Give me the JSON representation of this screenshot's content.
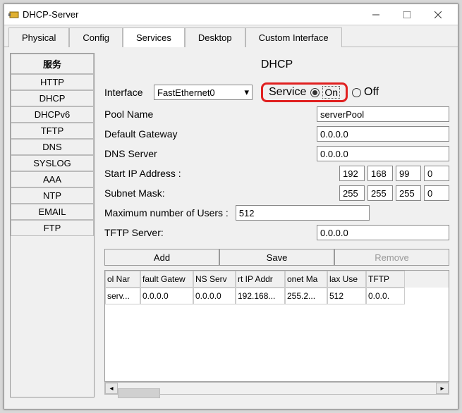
{
  "window": {
    "title": "DHCP-Server"
  },
  "tabs": [
    "Physical",
    "Config",
    "Services",
    "Desktop",
    "Custom Interface"
  ],
  "active_tab": "Services",
  "sidebar": {
    "header": "服务",
    "items": [
      "HTTP",
      "DHCP",
      "DHCPv6",
      "TFTP",
      "DNS",
      "SYSLOG",
      "AAA",
      "NTP",
      "EMAIL",
      "FTP"
    ]
  },
  "panel": {
    "title": "DHCP",
    "interface_label": "Interface",
    "interface_value": "FastEthernet0",
    "service_label": "Service",
    "on_label": "On",
    "off_label": "Off",
    "service_on": true,
    "fields": {
      "pool_name_label": "Pool Name",
      "pool_name_value": "serverPool",
      "gateway_label": "Default Gateway",
      "gateway_value": "0.0.0.0",
      "dns_label": "DNS Server",
      "dns_value": "0.0.0.0",
      "start_ip_label": "Start IP Address :",
      "start_ip": [
        "192",
        "168",
        "99",
        "0"
      ],
      "subnet_label": "Subnet Mask:",
      "subnet": [
        "255",
        "255",
        "255",
        "0"
      ],
      "max_users_label": "Maximum number of Users :",
      "max_users_value": "512",
      "tftp_label": "TFTP Server:",
      "tftp_value": "0.0.0.0"
    },
    "buttons": {
      "add": "Add",
      "save": "Save",
      "remove": "Remove"
    },
    "table": {
      "headers": [
        "ol Nar",
        "fault Gatew",
        "NS Serv",
        "rt IP Addr",
        "onet Ma",
        "lax Use",
        "TFTP"
      ],
      "rows": [
        [
          "serv...",
          "0.0.0.0",
          "0.0.0.0",
          "192.168...",
          "255.2...",
          "512",
          "0.0.0."
        ]
      ]
    }
  }
}
